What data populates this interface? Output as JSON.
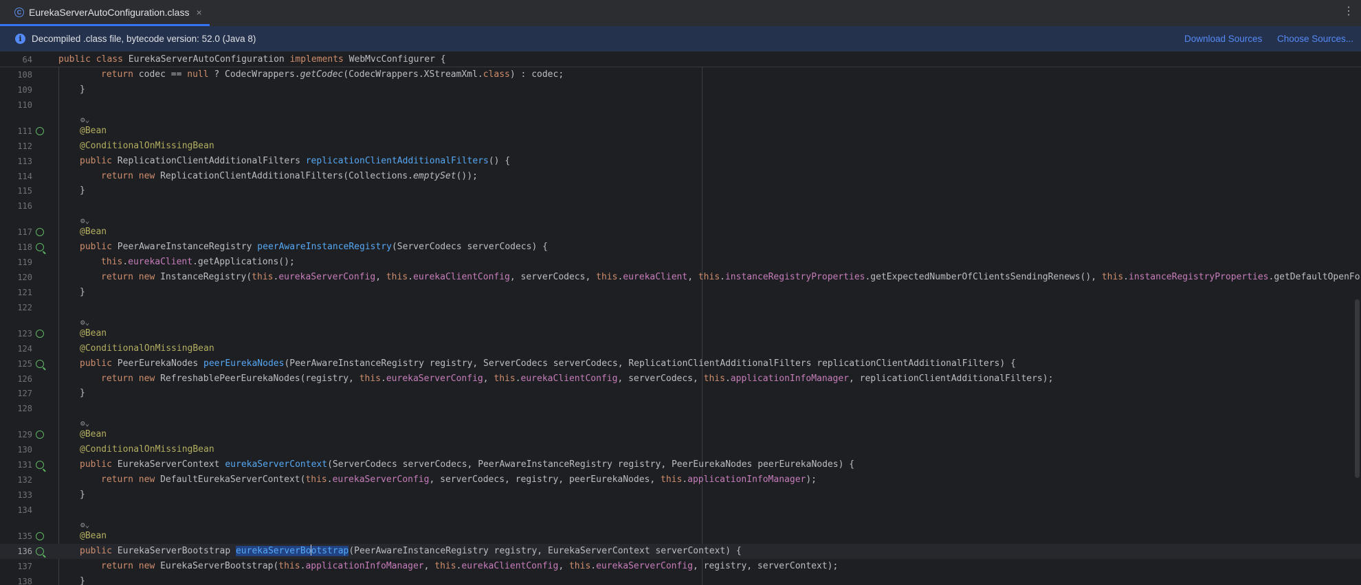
{
  "tab": {
    "label": "EurekaServerAutoConfiguration.class",
    "close": "×",
    "icon": "class-icon"
  },
  "banner": {
    "text": "Decompiled .class file, bytecode version: 52.0 (Java 8)",
    "download_sources": "Download Sources",
    "choose_sources": "Choose Sources..."
  },
  "sticky_line": {
    "num": "64",
    "text": "public class EurekaServerAutoConfiguration implements WebMvcConfigurer {"
  },
  "lines": [
    {
      "num": "108",
      "text": "return codec == null ? CodecWrappers.getCodec(CodecWrappers.XStreamXml.class) : codec;"
    },
    {
      "num": "109",
      "text": "}"
    },
    {
      "num": "110",
      "text": ""
    },
    {
      "num": "111",
      "text": "@Bean"
    },
    {
      "num": "112",
      "text": "@ConditionalOnMissingBean"
    },
    {
      "num": "113",
      "text": "public ReplicationClientAdditionalFilters replicationClientAdditionalFilters() {"
    },
    {
      "num": "114",
      "text": "return new ReplicationClientAdditionalFilters(Collections.emptySet());"
    },
    {
      "num": "115",
      "text": "}"
    },
    {
      "num": "116",
      "text": ""
    },
    {
      "num": "117",
      "text": "@Bean"
    },
    {
      "num": "118",
      "text": "public PeerAwareInstanceRegistry peerAwareInstanceRegistry(ServerCodecs serverCodecs) {"
    },
    {
      "num": "119",
      "text": "this.eurekaClient.getApplications();"
    },
    {
      "num": "120",
      "text": "return new InstanceRegistry(this.eurekaServerConfig, this.eurekaClientConfig, serverCodecs, this.eurekaClient, this.instanceRegistryProperties.getExpectedNumberOfClientsSendingRenews(), this.instanceRegistryProperties.getDefaultOpenFor"
    },
    {
      "num": "121",
      "text": "}"
    },
    {
      "num": "122",
      "text": ""
    },
    {
      "num": "123",
      "text": "@Bean"
    },
    {
      "num": "124",
      "text": "@ConditionalOnMissingBean"
    },
    {
      "num": "125",
      "text": "public PeerEurekaNodes peerEurekaNodes(PeerAwareInstanceRegistry registry, ServerCodecs serverCodecs, ReplicationClientAdditionalFilters replicationClientAdditionalFilters) {"
    },
    {
      "num": "126",
      "text": "return new RefreshablePeerEurekaNodes(registry, this.eurekaServerConfig, this.eurekaClientConfig, serverCodecs, this.applicationInfoManager, replicationClientAdditionalFilters);"
    },
    {
      "num": "127",
      "text": "}"
    },
    {
      "num": "128",
      "text": ""
    },
    {
      "num": "129",
      "text": "@Bean"
    },
    {
      "num": "130",
      "text": "@ConditionalOnMissingBean"
    },
    {
      "num": "131",
      "text": "public EurekaServerContext eurekaServerContext(ServerCodecs serverCodecs, PeerAwareInstanceRegistry registry, PeerEurekaNodes peerEurekaNodes) {"
    },
    {
      "num": "132",
      "text": "return new DefaultEurekaServerContext(this.eurekaServerConfig, serverCodecs, registry, peerEurekaNodes, this.applicationInfoManager);"
    },
    {
      "num": "133",
      "text": "}"
    },
    {
      "num": "134",
      "text": ""
    },
    {
      "num": "135",
      "text": "@Bean"
    },
    {
      "num": "136",
      "text": "public EurekaServerBootstrap eurekaServerBootstrap(PeerAwareInstanceRegistry registry, EurekaServerContext serverContext) {"
    },
    {
      "num": "137",
      "text": "return new EurekaServerBootstrap(this.applicationInfoManager, this.eurekaClientConfig, this.eurekaServerConfig, registry, serverContext);"
    },
    {
      "num": "138",
      "text": "}"
    }
  ],
  "inlay_hint": "⚙⌄",
  "colors": {
    "background": "#1e1f22",
    "keyword": "#cf8e6d",
    "annotation": "#b3ae60",
    "method": "#56a8f5",
    "field": "#c77dbb",
    "accent": "#3574f0"
  },
  "icons": [
    "class-icon",
    "info-icon",
    "more-options-icon",
    "bean-gutter-icon",
    "implementations-gutter-icon"
  ]
}
